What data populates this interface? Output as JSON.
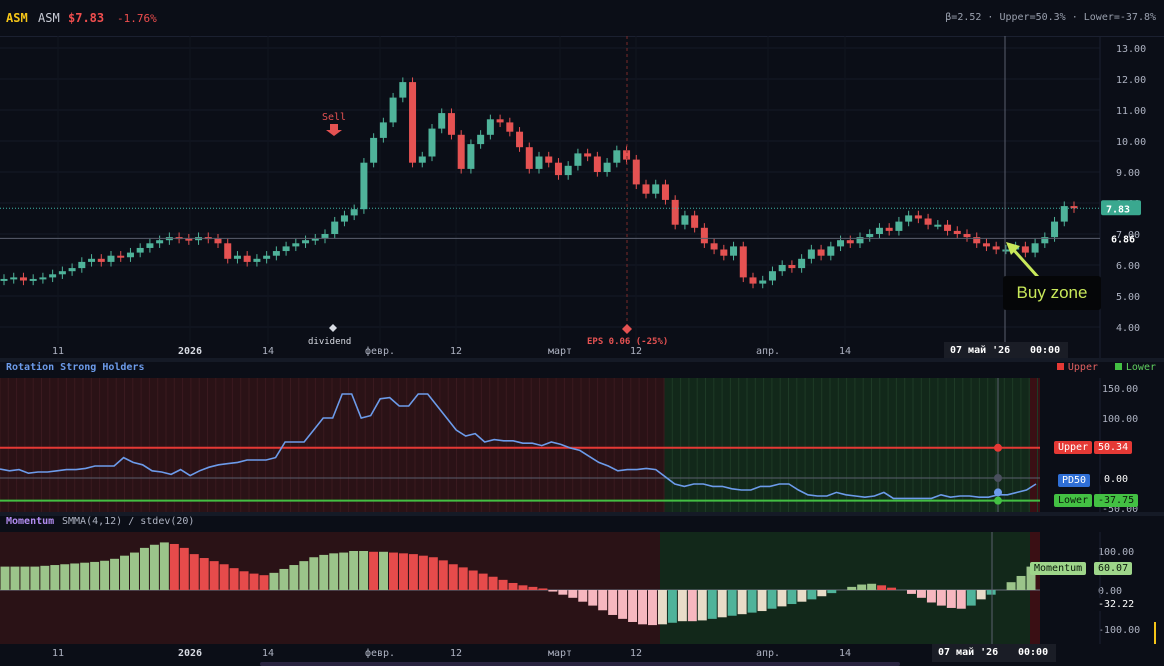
{
  "header": {
    "ticker": "ASM",
    "symbol": "ASM",
    "price": "$7.83",
    "change": "-1.76%",
    "stats": "β=2.52 · Upper=50.3% · Lower=-37.8%"
  },
  "main": {
    "y_ticks": [
      "13.00",
      "12.00",
      "11.00",
      "10.00",
      "9.00",
      "8.00",
      "7.00",
      "6.00",
      "5.00",
      "4.00"
    ],
    "price_label": "7.83",
    "ref_label": "6.86",
    "sell_label": "Sell",
    "eps_label": "EPS 0.06 (-25%)",
    "dividend_label": "dividend",
    "buy_zone_label": "Buy zone",
    "x_ticks": [
      "11",
      "2026",
      "14",
      "февр.",
      "12",
      "март",
      "12",
      "апр.",
      "14"
    ],
    "crosshair_date": "07 май '26",
    "crosshair_time": "00:00"
  },
  "rsh": {
    "title": "Rotation Strong Holders",
    "legend_upper": "Upper",
    "legend_lower": "Lower",
    "y_ticks": [
      "150.00",
      "100.00",
      "50.00",
      "0.00",
      "-50.00"
    ],
    "upper_name": "Upper",
    "upper_value": "50.34",
    "pd_name": "PD50",
    "pd_value": "0.00",
    "lower_name": "Lower",
    "lower_value": "-37.75",
    "colors": {
      "upper": "#e53935",
      "lower": "#43c043",
      "line": "#6c9bea"
    }
  },
  "momentum": {
    "title": "Momentum",
    "subtitle": "SMMA(4,12) / stdev(20)",
    "y_ticks": [
      "100.00",
      "50.00",
      "0.00",
      "-100.00"
    ],
    "label_name": "Momentum",
    "label_value": "60.07",
    "cur_value": "-32.22"
  },
  "bottom_axis": {
    "x_ticks": [
      "11",
      "2026",
      "14",
      "февр.",
      "12",
      "март",
      "12",
      "апр.",
      "14"
    ],
    "crosshair_date": "07 май '26",
    "crosshair_time": "00:00"
  },
  "chart_data": [
    {
      "type": "candlestick",
      "title": "ASM",
      "ylim": [
        3.7,
        13.3
      ],
      "x": [
        "11",
        "2026",
        "14",
        "февр.",
        "12",
        "март",
        "12",
        "апр.",
        "14"
      ],
      "close_series": [
        5.55,
        5.6,
        5.5,
        5.55,
        5.6,
        5.7,
        5.8,
        5.9,
        6.1,
        6.2,
        6.1,
        6.3,
        6.25,
        6.4,
        6.55,
        6.7,
        6.8,
        6.9,
        6.85,
        6.8,
        6.9,
        6.85,
        6.7,
        6.2,
        6.3,
        6.1,
        6.2,
        6.3,
        6.45,
        6.6,
        6.7,
        6.8,
        6.85,
        7.0,
        7.4,
        7.6,
        7.8,
        9.3,
        10.1,
        10.6,
        11.4,
        11.9,
        9.3,
        9.5,
        10.4,
        10.9,
        10.2,
        9.1,
        9.9,
        10.2,
        10.7,
        10.6,
        10.3,
        9.8,
        9.1,
        9.5,
        9.3,
        8.9,
        9.2,
        9.6,
        9.5,
        9.0,
        9.3,
        9.7,
        9.4,
        8.6,
        8.3,
        8.6,
        8.1,
        7.3,
        7.6,
        7.2,
        6.7,
        6.5,
        6.3,
        6.6,
        5.6,
        5.4,
        5.5,
        5.8,
        6.0,
        5.9,
        6.2,
        6.5,
        6.3,
        6.6,
        6.8,
        6.7,
        6.9,
        7.0,
        7.2,
        7.1,
        7.4,
        7.6,
        7.5,
        7.3,
        7.3,
        7.1,
        7.0,
        6.9,
        6.7,
        6.6,
        6.5,
        6.5,
        6.6,
        6.4,
        6.7,
        6.9,
        7.4,
        7.9,
        7.83
      ],
      "series": [
        {
          "name": "",
          "values": [
            5.55,
            5.6,
            5.5,
            5.55,
            5.6,
            5.7,
            5.8,
            5.9,
            6.1,
            6.2,
            6.1,
            6.3,
            6.25,
            6.4,
            6.55,
            6.7,
            6.8,
            6.9,
            6.85,
            6.8,
            6.9,
            6.85,
            6.7,
            6.2,
            6.3,
            6.1,
            6.2,
            6.3,
            6.45,
            6.6,
            6.7,
            6.8,
            6.85,
            7.0,
            7.4,
            7.6,
            7.8,
            9.3,
            10.1,
            10.6,
            11.4,
            11.9,
            9.3,
            9.5,
            10.4,
            10.9,
            10.2,
            9.1,
            9.9,
            10.2,
            10.7,
            10.6,
            10.3,
            9.8,
            9.1,
            9.5,
            9.3,
            8.9,
            9.2,
            9.6,
            9.5,
            9.0,
            9.3,
            9.7,
            9.4,
            8.6,
            8.3,
            8.6,
            8.1,
            7.3,
            7.6,
            7.2,
            6.7,
            6.5,
            6.3,
            6.6,
            5.6,
            5.4,
            5.5,
            5.8,
            6.0,
            5.9,
            6.2,
            6.5,
            6.3,
            6.6,
            6.8,
            6.7,
            6.9,
            7.0,
            7.2,
            7.1,
            7.4,
            7.6,
            7.5,
            7.3,
            7.3,
            7.1,
            7.0,
            6.9,
            6.7,
            6.6,
            6.5,
            6.5,
            6.6,
            6.4,
            6.7,
            6.9,
            7.4,
            7.9,
            7.83
          ]
        }
      ]
    },
    {
      "type": "line",
      "title": "Rotation Strong Holders",
      "ylim": [
        -70,
        175
      ],
      "series": [
        {
          "name": "",
          "values": [
            15,
            12,
            14,
            8,
            10,
            10,
            12,
            14,
            14,
            16,
            20,
            20,
            20,
            34,
            26,
            22,
            12,
            10,
            6,
            14,
            4,
            12,
            18,
            22,
            24,
            26,
            30,
            30,
            30,
            34,
            60,
            60,
            60,
            80,
            100,
            100,
            140,
            140,
            100,
            104,
            132,
            134,
            120,
            120,
            140,
            140,
            120,
            100,
            80,
            70,
            74,
            60,
            64,
            62,
            62,
            58,
            58,
            54,
            60,
            56,
            50,
            46,
            36,
            26,
            20,
            12,
            14,
            14,
            16,
            14,
            2,
            -10,
            -14,
            -10,
            -10,
            -14,
            -14,
            -18,
            -20,
            -20,
            -14,
            -14,
            -10,
            -10,
            -20,
            -28,
            -30,
            -30,
            -24,
            -28,
            -30,
            -32,
            -30,
            -24,
            -34,
            -34,
            -34,
            -34,
            -34,
            -28,
            -32,
            -30,
            -30,
            -32,
            -32,
            -28,
            -28,
            -24,
            -20,
            -10
          ]
        },
        {
          "name": "Upper",
          "values": [
            50.34
          ]
        },
        {
          "name": "PD50",
          "values": [
            0.0
          ]
        },
        {
          "name": "Lower",
          "values": [
            -37.75
          ]
        }
      ]
    },
    {
      "type": "bar",
      "title": "Momentum",
      "ylim": [
        -110,
        130
      ],
      "series": [
        {
          "name": "Momentum",
          "values": [
            60,
            60,
            60,
            60,
            62,
            64,
            66,
            68,
            70,
            72,
            75,
            80,
            88,
            96,
            108,
            116,
            122,
            118,
            108,
            92,
            82,
            74,
            66,
            56,
            48,
            42,
            38,
            44,
            54,
            64,
            74,
            84,
            90,
            94,
            96,
            100,
            100,
            98,
            98,
            96,
            94,
            92,
            88,
            84,
            76,
            66,
            58,
            50,
            42,
            34,
            26,
            18,
            12,
            8,
            4,
            -4,
            -12,
            -20,
            -30,
            -40,
            -52,
            -64,
            -74,
            -82,
            -88,
            -90,
            -88,
            -84,
            -80,
            -80,
            -78,
            -74,
            -70,
            -66,
            -62,
            -58,
            -54,
            -48,
            -42,
            -36,
            -30,
            -24,
            -16,
            -8,
            0,
            8,
            14,
            16,
            12,
            6,
            0,
            -10,
            -20,
            -32,
            -40,
            -46,
            -48,
            -40,
            -24,
            -12,
            0,
            20,
            36,
            60
          ]
        }
      ]
    }
  ]
}
